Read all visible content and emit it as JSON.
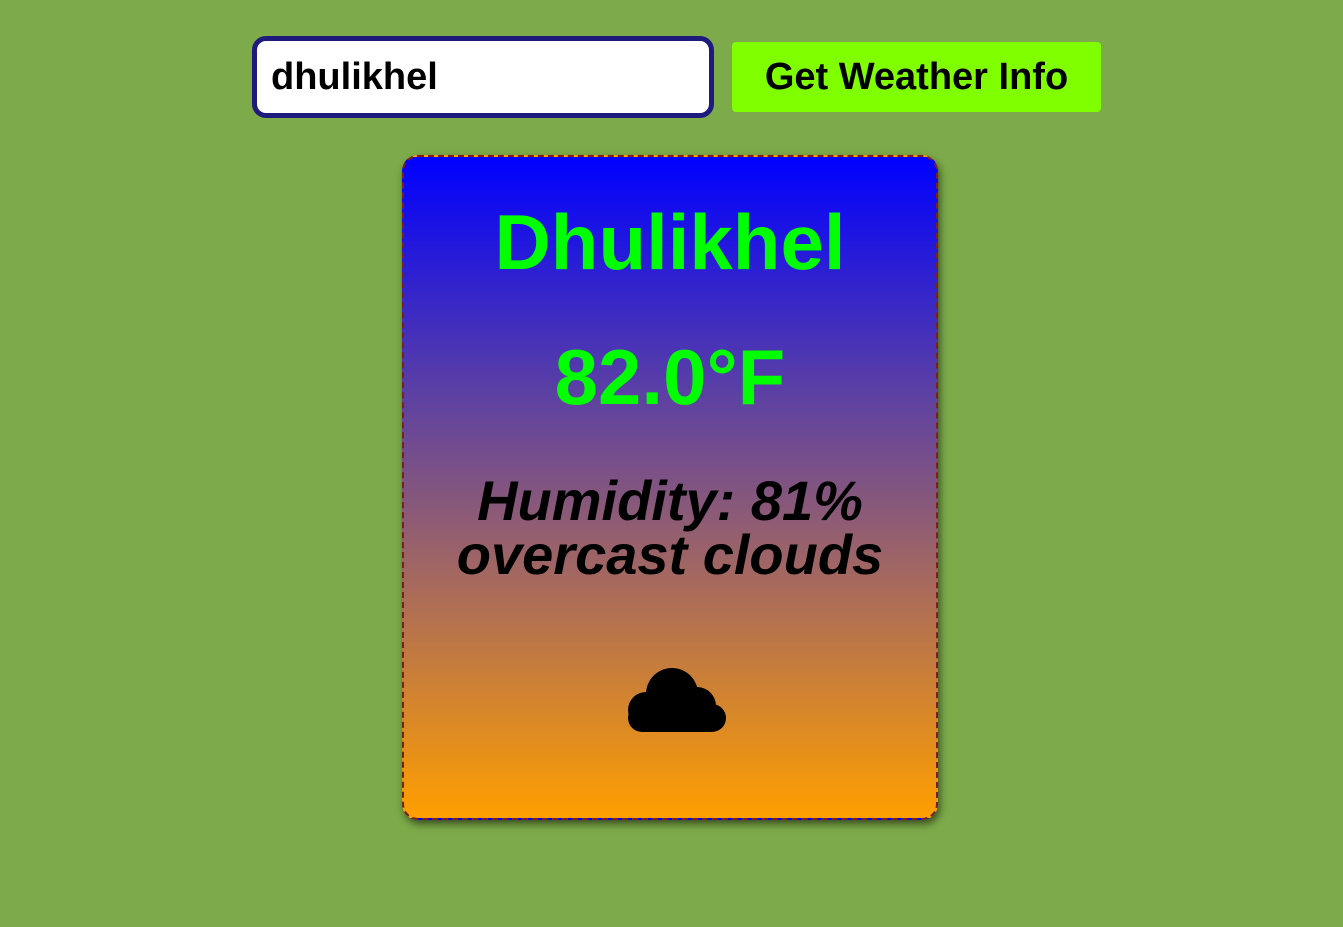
{
  "search": {
    "input_value": "dhulikhel",
    "button_label": "Get Weather Info"
  },
  "weather": {
    "city": "Dhulikhel",
    "temperature": "82.0°F",
    "humidity": "Humidity: 81%",
    "description": "overcast clouds",
    "icon": "cloud-icon"
  },
  "colors": {
    "background": "#7dab49",
    "button": "#7fff00",
    "input_border": "#1f1b7e",
    "headline_text": "#00ff00",
    "card_gradient_top": "#0000ff",
    "card_gradient_bottom": "#ff9f00"
  }
}
